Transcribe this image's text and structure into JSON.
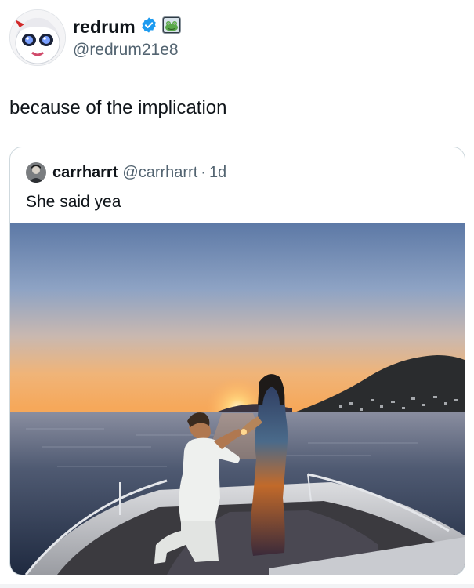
{
  "tweet": {
    "author": {
      "display_name": "redrum",
      "handle": "@redrum21e8",
      "verified": true,
      "badge_icon": "frog-badge-icon"
    },
    "text": "because of the implication",
    "quoted": {
      "author": {
        "display_name": "carrharrt",
        "handle": "@carrharrt",
        "separator": "·",
        "time": "1d"
      },
      "text": "She said yea",
      "media": {
        "type": "photo"
      }
    }
  },
  "colors": {
    "verified_blue": "#1d9bf0",
    "text_primary": "#0f1419",
    "text_secondary": "#536471",
    "border": "#cfd9de"
  }
}
